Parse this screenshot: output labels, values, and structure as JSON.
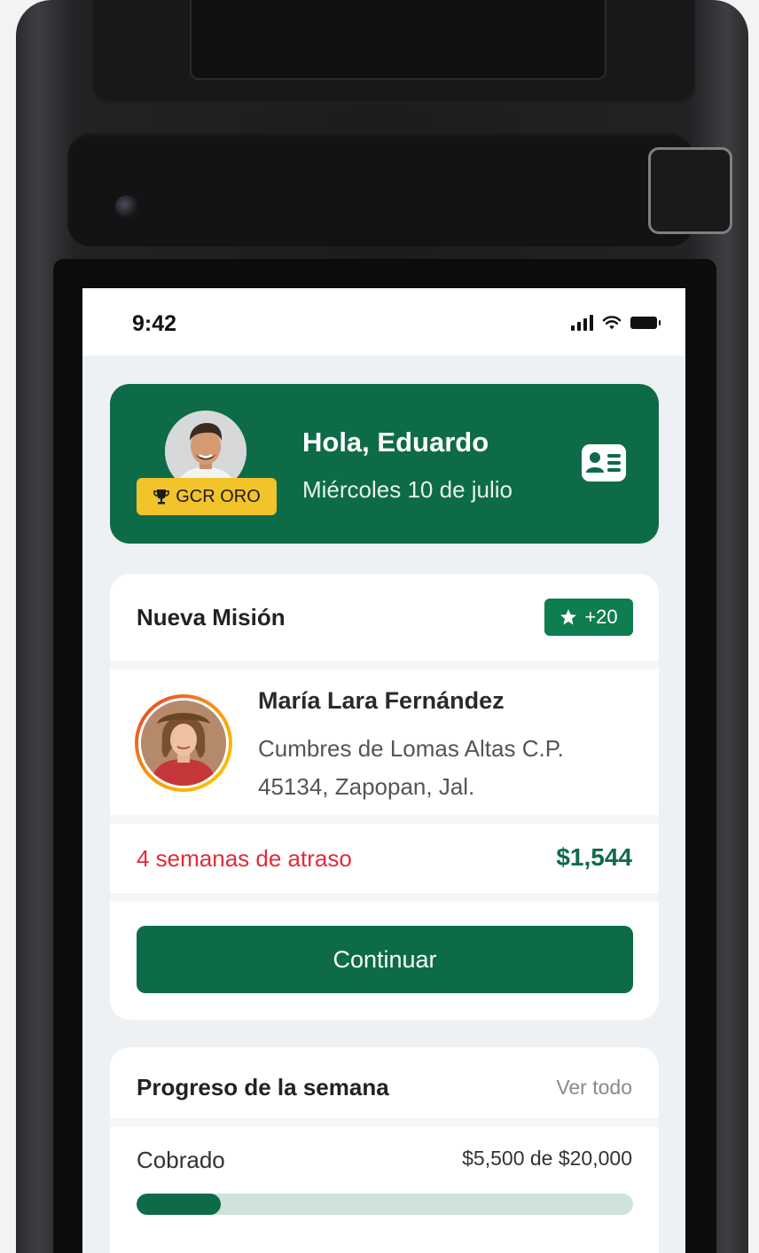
{
  "status_bar": {
    "time": "9:42",
    "icons": [
      "signal-icon",
      "wifi-icon",
      "battery-icon"
    ]
  },
  "header": {
    "greeting": "Hola, Eduardo",
    "date": "Miércoles 10 de julio",
    "badge_label": "GCR ORO",
    "badge_icon": "trophy-icon",
    "action_icon": "id-card-icon"
  },
  "mission": {
    "title": "Nueva Misión",
    "points": "+20",
    "points_icon": "star-icon",
    "client": {
      "name": "María Lara Fernández",
      "address": "Cumbres de Lomas Altas C.P. 45134, Zapopan, Jal."
    },
    "overdue_text": "4 semanas de atraso",
    "amount": "$1,544",
    "continue_label": "Continuar"
  },
  "progress": {
    "title": "Progreso de la semana",
    "see_all": "Ver todo",
    "collected_label": "Cobrado",
    "collected_value": "$5,500 de $20,000",
    "collected_fraction": 0.17
  },
  "colors": {
    "brand_green": "#0e6b48",
    "badge_gold": "#f2c32a",
    "alert_red": "#e32b3a",
    "track_green": "#cfe3da"
  }
}
